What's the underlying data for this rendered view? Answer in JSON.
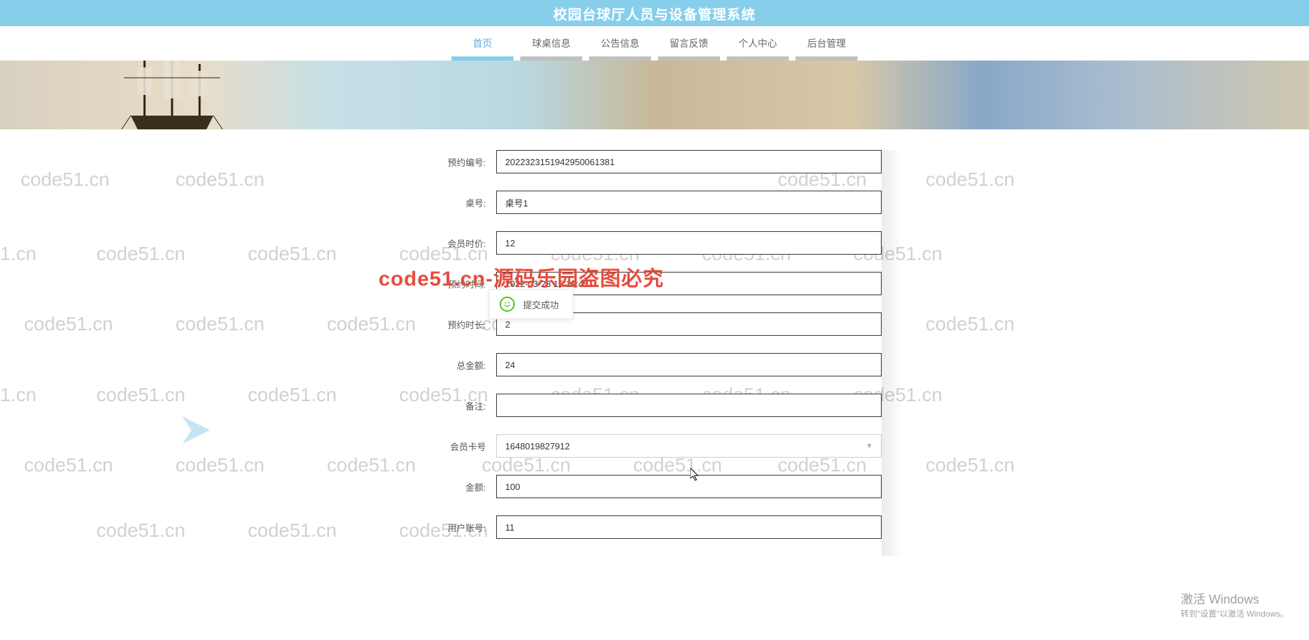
{
  "header": {
    "title": "校园台球厅人员与设备管理系统"
  },
  "nav": {
    "items": [
      {
        "label": "首页",
        "active": true
      },
      {
        "label": "球桌信息",
        "active": false
      },
      {
        "label": "公告信息",
        "active": false
      },
      {
        "label": "留言反馈",
        "active": false
      },
      {
        "label": "个人中心",
        "active": false
      },
      {
        "label": "后台管理",
        "active": false
      }
    ]
  },
  "form": {
    "fields": [
      {
        "label": "预约编号:",
        "value": "2022323151942950061381"
      },
      {
        "label": "桌号:",
        "value": "桌号1"
      },
      {
        "label": "会员时价:",
        "value": "12"
      },
      {
        "label": "预约时间:",
        "value": "2022-03-23 15:19:45"
      },
      {
        "label": "预约时长:",
        "value": "2"
      },
      {
        "label": "总金额:",
        "value": "24"
      },
      {
        "label": "备注:",
        "value": ""
      },
      {
        "label": "会员卡号",
        "value": "1648019827912",
        "type": "select"
      },
      {
        "label": "金额:",
        "value": "100"
      },
      {
        "label": "用户账号:",
        "value": "11"
      }
    ]
  },
  "toast": {
    "message": "提交成功"
  },
  "watermark": {
    "text": "code51.cn",
    "red": "code51.cn-源码乐园盗图必究"
  },
  "windowsActivate": {
    "line1": "激活 Windows",
    "line2": "转到\"设置\"以激活 Windows。"
  }
}
